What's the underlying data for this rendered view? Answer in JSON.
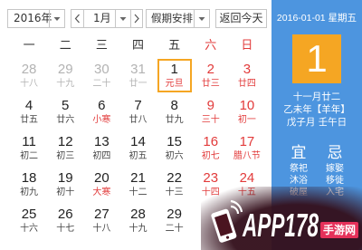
{
  "toolbar": {
    "year_value": "2016年",
    "month_value": "1月",
    "holiday_value": "假期安排",
    "today_label": "返回今天",
    "icons": {
      "dropdown": "chevron-down-icon",
      "prev": "chevron-left-icon",
      "next": "chevron-right-icon"
    }
  },
  "calendar": {
    "weekdays": [
      "一",
      "二",
      "三",
      "四",
      "五",
      "六",
      "日"
    ],
    "weeks": [
      [
        {
          "day": "28",
          "lunar": "十八",
          "other_month": true
        },
        {
          "day": "29",
          "lunar": "十九",
          "other_month": true
        },
        {
          "day": "30",
          "lunar": "二十",
          "other_month": true
        },
        {
          "day": "31",
          "lunar": "廿一",
          "other_month": true
        },
        {
          "day": "1",
          "lunar": "元旦",
          "festival": true,
          "selected": true
        },
        {
          "day": "2",
          "lunar": "廿三"
        },
        {
          "day": "3",
          "lunar": "廿四"
        }
      ],
      [
        {
          "day": "4",
          "lunar": "廿五"
        },
        {
          "day": "5",
          "lunar": "廿六"
        },
        {
          "day": "6",
          "lunar": "小寒",
          "festival": true
        },
        {
          "day": "7",
          "lunar": "廿八"
        },
        {
          "day": "8",
          "lunar": "廿九"
        },
        {
          "day": "9",
          "lunar": "三十"
        },
        {
          "day": "10",
          "lunar": "初一"
        }
      ],
      [
        {
          "day": "11",
          "lunar": "初二"
        },
        {
          "day": "12",
          "lunar": "初三"
        },
        {
          "day": "13",
          "lunar": "初四"
        },
        {
          "day": "14",
          "lunar": "初五"
        },
        {
          "day": "15",
          "lunar": "初六"
        },
        {
          "day": "16",
          "lunar": "初七"
        },
        {
          "day": "17",
          "lunar": "腊八节",
          "festival": true
        }
      ],
      [
        {
          "day": "18",
          "lunar": "初九"
        },
        {
          "day": "19",
          "lunar": "初十"
        },
        {
          "day": "20",
          "lunar": "大寒",
          "festival": true
        },
        {
          "day": "21",
          "lunar": "十二"
        },
        {
          "day": "22",
          "lunar": "十三"
        },
        {
          "day": "23",
          "lunar": "十四"
        },
        {
          "day": "24",
          "lunar": "十五"
        }
      ],
      [
        {
          "day": "25",
          "lunar": "十六"
        },
        {
          "day": "26",
          "lunar": "十七"
        },
        {
          "day": "27",
          "lunar": "十八"
        },
        {
          "day": "28",
          "lunar": "十九"
        },
        {
          "day": "29",
          "lunar": "二十"
        }
      ]
    ]
  },
  "detail": {
    "date_line": "2016-01-01 星期五",
    "big_day": "1",
    "lunar_date": "十一月廿二",
    "year_ganzhi": "乙未年【羊年】",
    "month_day_ganzhi": "戊子月 壬午日",
    "yi_label": "宜",
    "ji_label": "忌",
    "yi_items": [
      "祭祀",
      "沐浴",
      "破屋"
    ],
    "ji_items": [
      "嫁娶",
      "移徙",
      "入宅"
    ]
  },
  "watermark": {
    "brand": "APP178",
    "suffix": "手游网",
    "icon": "phone-signal-icon"
  },
  "colors": {
    "panel_blue": "#4d95df",
    "selected_orange": "#f5a623",
    "holiday_red": "#e23b3b",
    "muted_gray": "#b3b3b3"
  }
}
